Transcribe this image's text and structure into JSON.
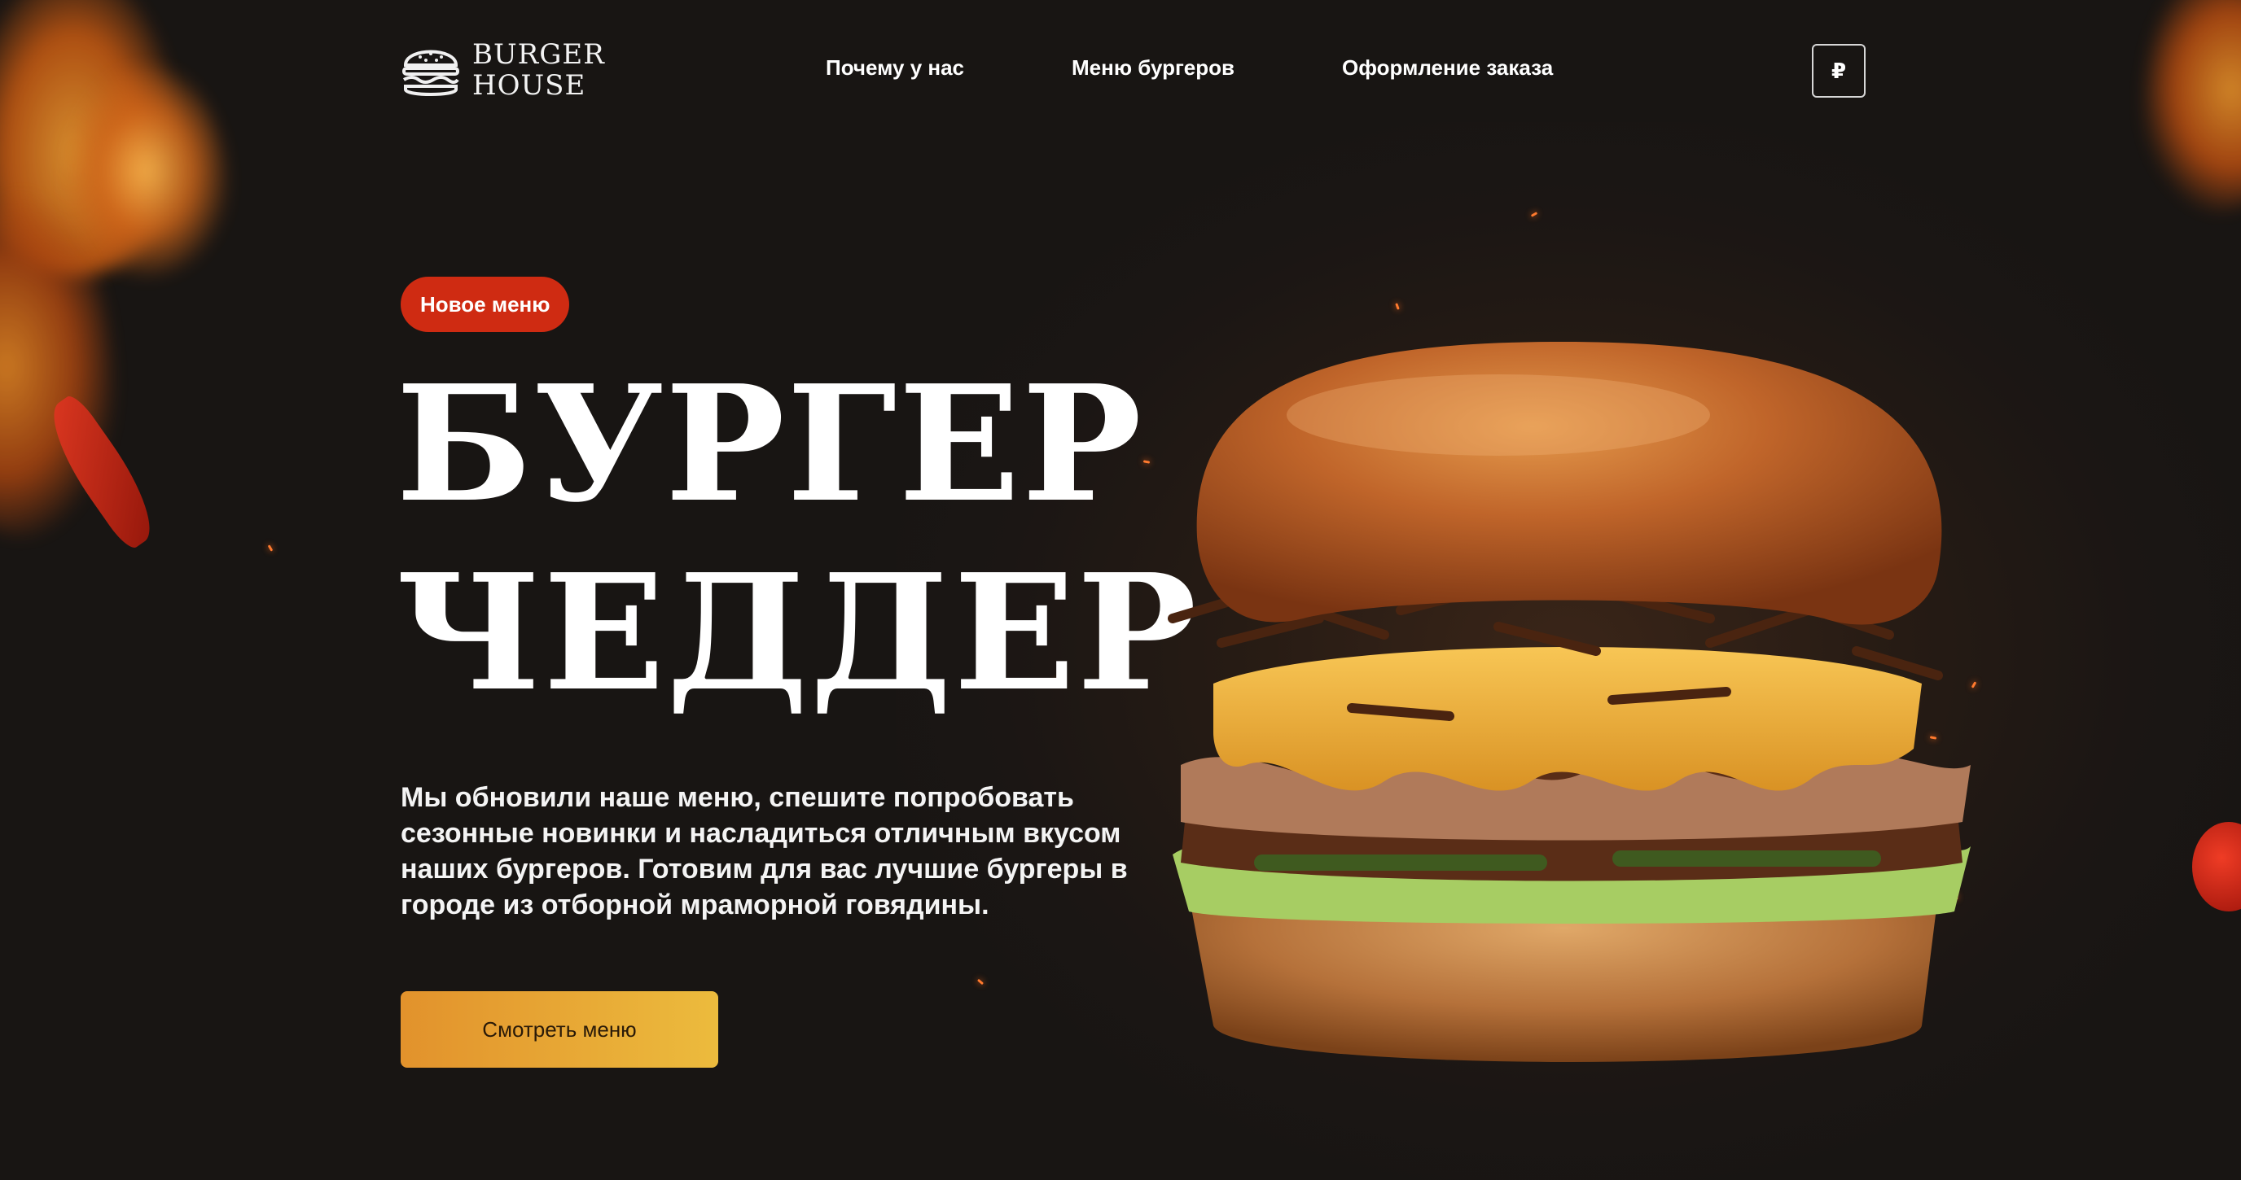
{
  "brand": {
    "logo_line1": "BURGER",
    "logo_line2": "HOUSE",
    "icon": "burger-logo-icon"
  },
  "nav": {
    "items": [
      {
        "label": "Почему у нас"
      },
      {
        "label": "Меню бургеров"
      },
      {
        "label": "Оформление заказа"
      }
    ],
    "currency_label": "₽"
  },
  "hero": {
    "badge": "Новое меню",
    "title_line1": "БУРГЕР",
    "title_line2": "ЧЕДДЕР",
    "description": "Мы обновили наше меню, спешите попробовать сезонные новинки и насладиться отличным вкусом наших бургеров. Готовим для вас лучшие бургеры в городе из отборной мраморной говядины.",
    "cta_label": "Смотреть меню",
    "image": "cheddar-burger-image"
  },
  "colors": {
    "background": "#181513",
    "badge": "#cf2b12",
    "cta_start": "#e2922c",
    "cta_end": "#ecbb3d",
    "text": "#ffffff"
  }
}
